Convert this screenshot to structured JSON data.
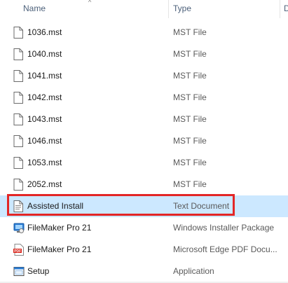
{
  "columns": {
    "name": "Name",
    "type": "Type",
    "next": "D"
  },
  "files": [
    {
      "name": "1036.mst",
      "type": "MST File",
      "icon": "document-icon"
    },
    {
      "name": "1040.mst",
      "type": "MST File",
      "icon": "document-icon"
    },
    {
      "name": "1041.mst",
      "type": "MST File",
      "icon": "document-icon"
    },
    {
      "name": "1042.mst",
      "type": "MST File",
      "icon": "document-icon"
    },
    {
      "name": "1043.mst",
      "type": "MST File",
      "icon": "document-icon"
    },
    {
      "name": "1046.mst",
      "type": "MST File",
      "icon": "document-icon"
    },
    {
      "name": "1053.mst",
      "type": "MST File",
      "icon": "document-icon"
    },
    {
      "name": "2052.mst",
      "type": "MST File",
      "icon": "document-icon"
    },
    {
      "name": "Assisted Install",
      "type": "Text Document",
      "icon": "text-document-icon",
      "selected": true
    },
    {
      "name": "FileMaker Pro 21",
      "type": "Windows Installer Package",
      "icon": "installer-package-icon"
    },
    {
      "name": "FileMaker Pro 21",
      "type": "Microsoft Edge PDF Docu...",
      "icon": "pdf-icon"
    },
    {
      "name": "Setup",
      "type": "Application",
      "icon": "application-icon"
    }
  ],
  "colors": {
    "selection": "#cce8ff",
    "highlight": "#e32626"
  }
}
